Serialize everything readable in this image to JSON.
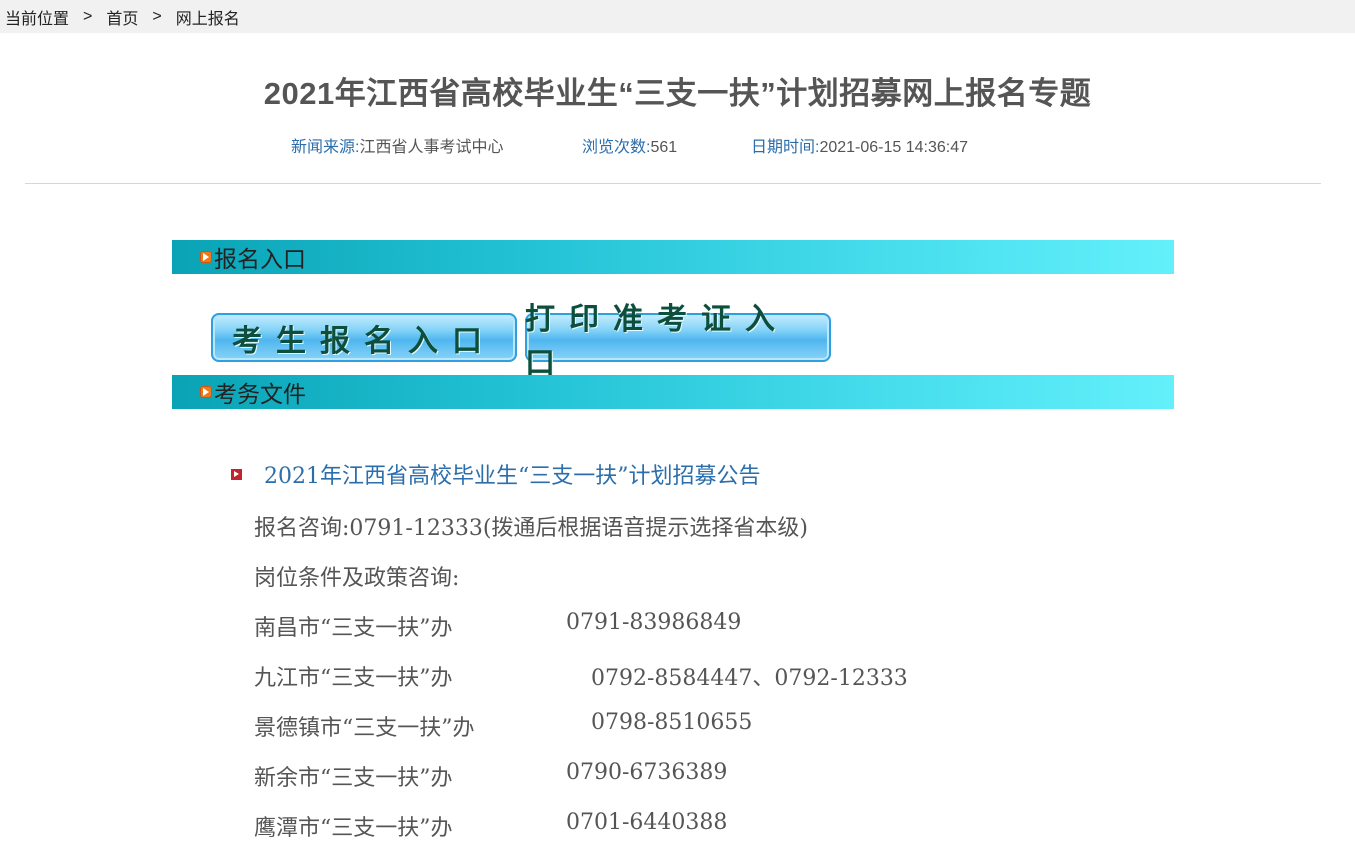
{
  "breadcrumb": {
    "label": "当前位置",
    "sep": ">",
    "home": "首页",
    "current": "网上报名"
  },
  "article": {
    "title": "2021年江西省高校毕业生“三支一扶”计划招募网上报名专题",
    "source_label": "新闻来源:",
    "source_value": "江西省人事考试中心",
    "views_label": "浏览次数:",
    "views_value": "561",
    "date_label": "日期时间:",
    "date_value": "2021-06-15 14:36:47"
  },
  "sections": {
    "signup": "报名入口",
    "docs": "考务文件"
  },
  "buttons": {
    "signup": "考生报名入口",
    "print": "打印准考证入口"
  },
  "content": {
    "notice_link": "2021年江西省高校毕业生“三支一扶”计划招募公告",
    "consult": "报名咨询:0791-12333(拨通后根据语音提示选择省本级)",
    "policy": "岗位条件及政策咨询:",
    "offices": [
      {
        "name": "南昌市“三支一扶”办",
        "phone": "0791-83986849"
      },
      {
        "name": "九江市“三支一扶”办",
        "phone": "0792-8584447、0792-12333"
      },
      {
        "name": "景德镇市“三支一扶”办",
        "phone": "0798-8510655"
      },
      {
        "name": "新余市“三支一扶”办",
        "phone": "0790-6736389"
      },
      {
        "name": "鹰潭市“三支一扶”办",
        "phone": "0701-6440388"
      }
    ]
  },
  "colors": {
    "accent_blue": "#2b6eab",
    "bar_start": "#0aa3b6",
    "bar_end": "#63f0fb",
    "bullet_orange": "#f0781a",
    "icon_red": "#c0242c"
  }
}
